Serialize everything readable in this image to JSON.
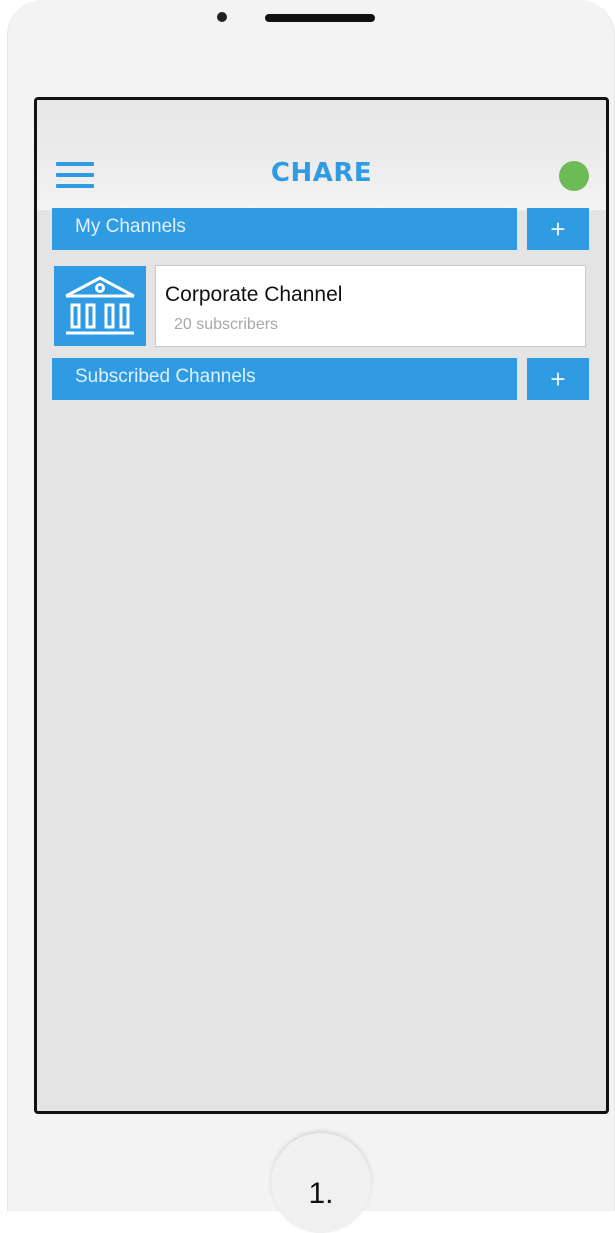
{
  "app": {
    "title": "CHARE",
    "status_color": "#6dbb57",
    "accent_color": "#2f9be3"
  },
  "my_channels": {
    "label": "My Channels",
    "add_label": "+",
    "items": [
      {
        "name": "Corporate Channel",
        "subscribers": "20 subscribers",
        "icon": "institution-building-icon"
      }
    ]
  },
  "subscribed_channels": {
    "label": "Subscribed Channels",
    "add_label": "+"
  },
  "device": {
    "home_label": "1."
  }
}
